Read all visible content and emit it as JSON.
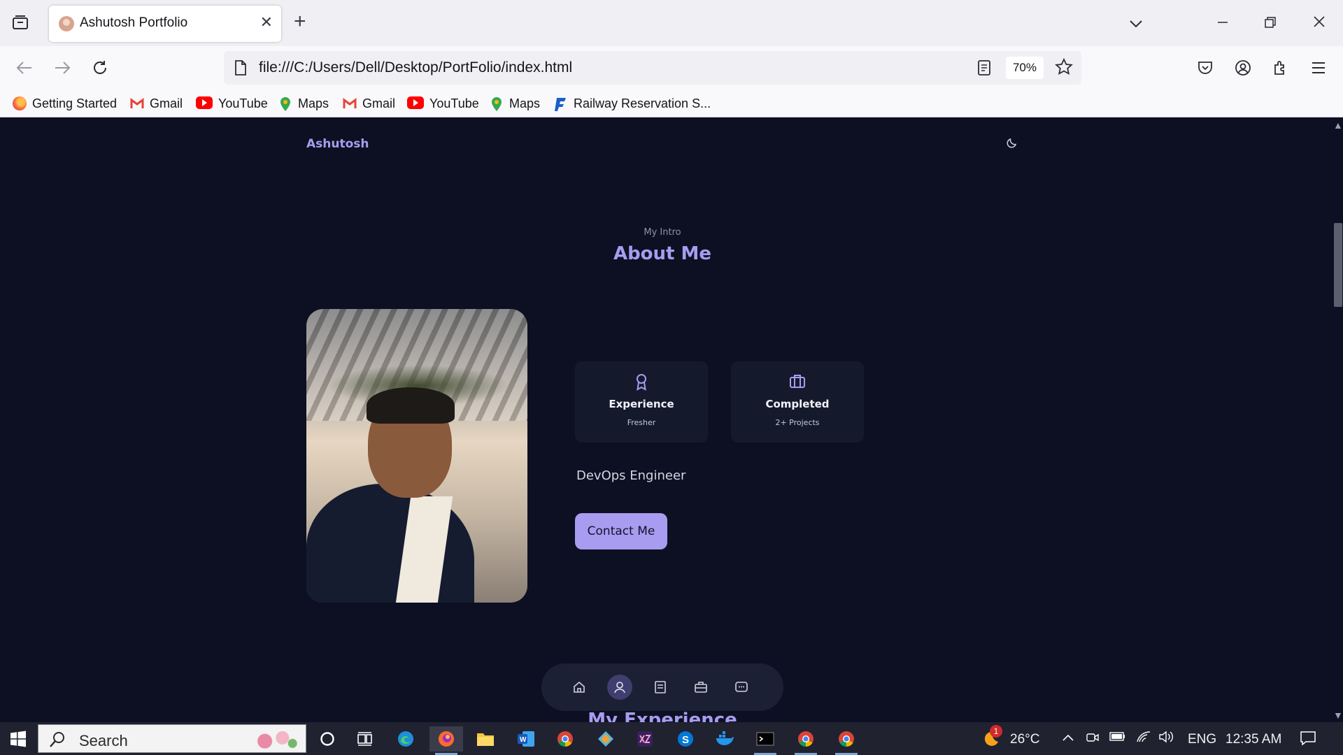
{
  "browser": {
    "tab_title": "Ashutosh Portfolio",
    "new_tab": "+",
    "close_tab": "✕",
    "url": "file:///C:/Users/Dell/Desktop/PortFolio/index.html",
    "zoom": "70%",
    "bookmarks": [
      {
        "label": "Getting Started",
        "icon": "firefox-icon"
      },
      {
        "label": "Gmail",
        "icon": "gmail-icon"
      },
      {
        "label": "YouTube",
        "icon": "youtube-icon"
      },
      {
        "label": "Maps",
        "icon": "maps-icon"
      },
      {
        "label": "Gmail",
        "icon": "gmail-icon"
      },
      {
        "label": "YouTube",
        "icon": "youtube-icon"
      },
      {
        "label": "Maps",
        "icon": "maps-icon"
      },
      {
        "label": "Railway Reservation S...",
        "icon": "railway-icon"
      }
    ]
  },
  "page": {
    "logo": "Ashutosh",
    "subtitle": "My Intro",
    "title": "About Me",
    "cards": [
      {
        "title": "Experience",
        "subtitle": "Fresher",
        "icon": "award-icon"
      },
      {
        "title": "Completed",
        "subtitle": "2+ Projects",
        "icon": "briefcase-icon"
      }
    ],
    "role": "DevOps Engineer",
    "contact_button": "Contact Me",
    "next_section_title": "My Experience",
    "bottom_nav": [
      "home-icon",
      "user-icon",
      "file-icon",
      "briefcase-icon",
      "message-icon"
    ],
    "active_nav": "user-icon"
  },
  "taskbar": {
    "search_label": "Search",
    "weather": "26°C",
    "weather_badge": "1",
    "language": "ENG",
    "time": "12:35 AM"
  },
  "colors": {
    "accent": "#a79cf0",
    "page_background": "#0c1022",
    "card_background": "#141a2c"
  }
}
